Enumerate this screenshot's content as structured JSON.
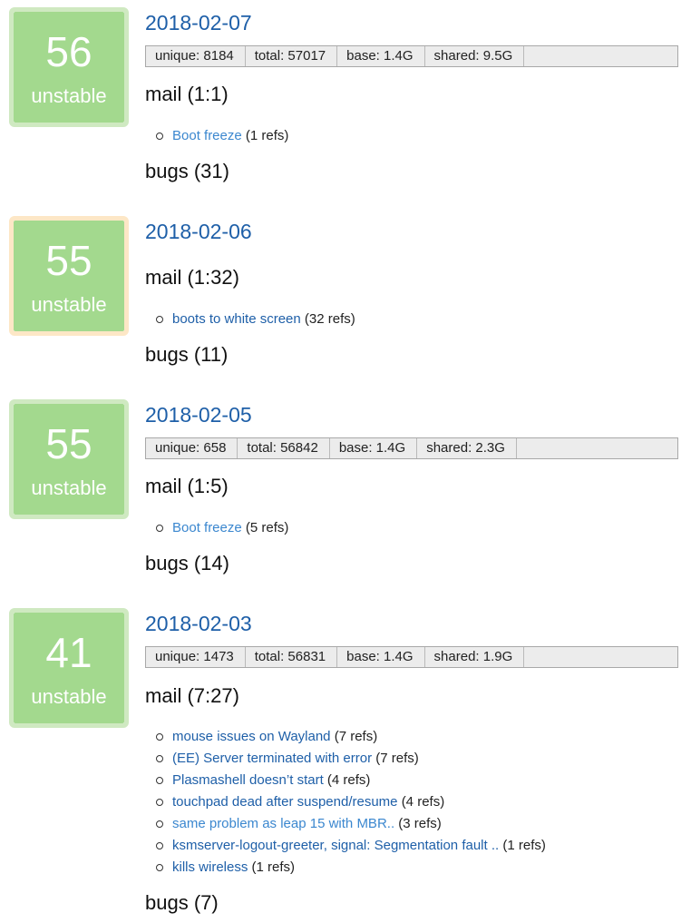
{
  "colors": {
    "link": "#1e5fa8",
    "badge_fill": "#a3d98e",
    "badge_border_green": "#cfe9c1",
    "badge_border_orange": "#fde7c6"
  },
  "entries": [
    {
      "score": "56",
      "status": "unstable",
      "date": "2018-02-07",
      "stats": [
        "unique: 8184",
        "total: 57017",
        "base: 1.4G",
        "shared: 9.5G"
      ],
      "mail_heading": "mail (1:1)",
      "mail": [
        {
          "title": "Boot freeze",
          "count": "(1 refs)"
        }
      ],
      "bugs_heading": "bugs (31)"
    },
    {
      "score": "55",
      "status": "unstable",
      "date": "2018-02-06",
      "mail_heading": "mail (1:32)",
      "mail": [
        {
          "title": "boots to white screen",
          "count": "(32 refs)"
        }
      ],
      "bugs_heading": "bugs (11)"
    },
    {
      "score": "55",
      "status": "unstable",
      "date": "2018-02-05",
      "stats": [
        "unique: 658",
        "total: 56842",
        "base: 1.4G",
        "shared: 2.3G"
      ],
      "mail_heading": "mail (1:5)",
      "mail": [
        {
          "title": "Boot freeze",
          "count": "(5 refs)"
        }
      ],
      "bugs_heading": "bugs (14)"
    },
    {
      "score": "41",
      "status": "unstable",
      "date": "2018-02-03",
      "stats": [
        "unique: 1473",
        "total: 56831",
        "base: 1.4G",
        "shared: 1.9G"
      ],
      "mail_heading": "mail (7:27)",
      "mail": [
        {
          "title": "mouse issues on Wayland",
          "count": "(7 refs)"
        },
        {
          "title": "(EE) Server terminated with error",
          "count": "(7 refs)"
        },
        {
          "title": "Plasmashell doesn’t start",
          "count": "(4 refs)"
        },
        {
          "title": "touchpad dead after suspend/resume",
          "count": "(4 refs)"
        },
        {
          "title": "same problem as leap 15 with MBR..",
          "count": "(3 refs)"
        },
        {
          "title": "ksmserver-logout-greeter, signal: Segmentation fault ..",
          "count": "(1 refs)"
        },
        {
          "title": "kills wireless",
          "count": "(1 refs)"
        }
      ],
      "bugs_heading": "bugs (7)"
    }
  ]
}
